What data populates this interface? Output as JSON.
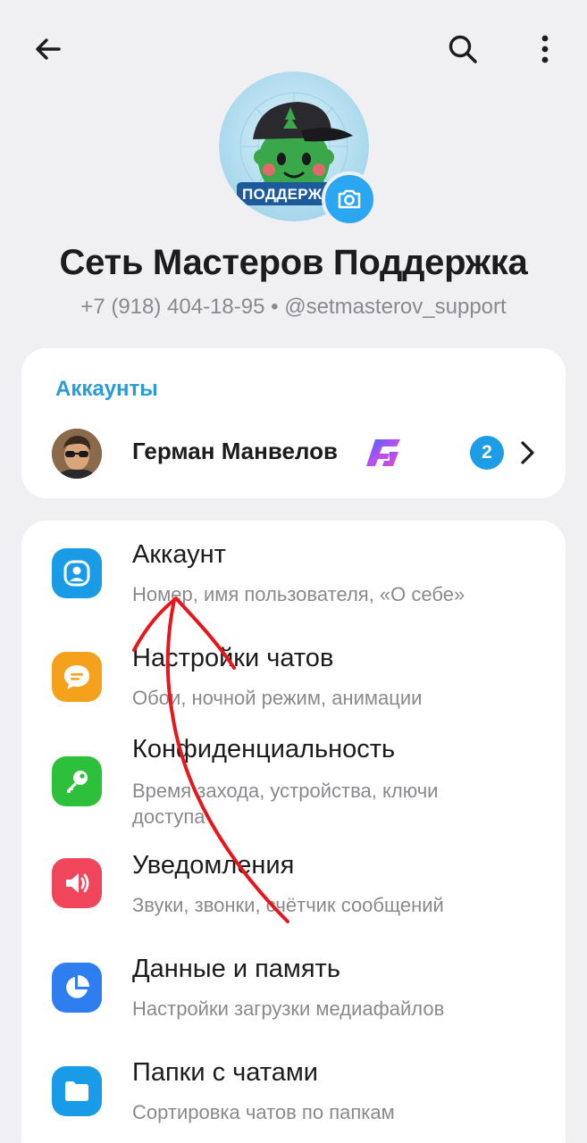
{
  "header": {
    "back_icon": "arrow-left-icon",
    "search_icon": "search-icon",
    "more_icon": "more-vertical-icon"
  },
  "profile": {
    "name": "Сеть Мастеров Поддержка",
    "phone": "+7 (918) 404-18-95",
    "separator": "•",
    "username": "@setmasterov_support",
    "avatar_badge_text": "ПОДДЕРЖ",
    "camera_icon": "camera-icon"
  },
  "accounts": {
    "title": "Аккаунты",
    "items": [
      {
        "name": "Герман Манвелов",
        "badge": "2",
        "premium_icon": "premium-star-icon"
      }
    ]
  },
  "settings": {
    "items": [
      {
        "title": "Аккаунт",
        "subtitle": "Номер, имя пользователя, «О себе»",
        "icon": "person-icon",
        "color": "#1a9be8"
      },
      {
        "title": "Настройки чатов",
        "subtitle": "Обои, ночной режим, анимации",
        "icon": "chat-bubble-icon",
        "color": "#f5a11c"
      },
      {
        "title": "Конфиденциальность",
        "subtitle": "Время захода, устройства, ключи доступа",
        "icon": "key-icon",
        "color": "#2dc03a"
      },
      {
        "title": "Уведомления",
        "subtitle": "Звуки, звонки, счётчик сообщений",
        "icon": "speaker-icon",
        "color": "#f0455b"
      },
      {
        "title": "Данные и память",
        "subtitle": "Настройки загрузки медиафайлов",
        "icon": "pie-chart-icon",
        "color": "#2f7ef0"
      },
      {
        "title": "Папки с чатами",
        "subtitle": "Сортировка чатов по папкам",
        "icon": "folder-icon",
        "color": "#1a9be8"
      }
    ]
  },
  "colors": {
    "background": "#f0f0f3",
    "accent": "#2b9bd8",
    "annotation": "#e8161b"
  }
}
